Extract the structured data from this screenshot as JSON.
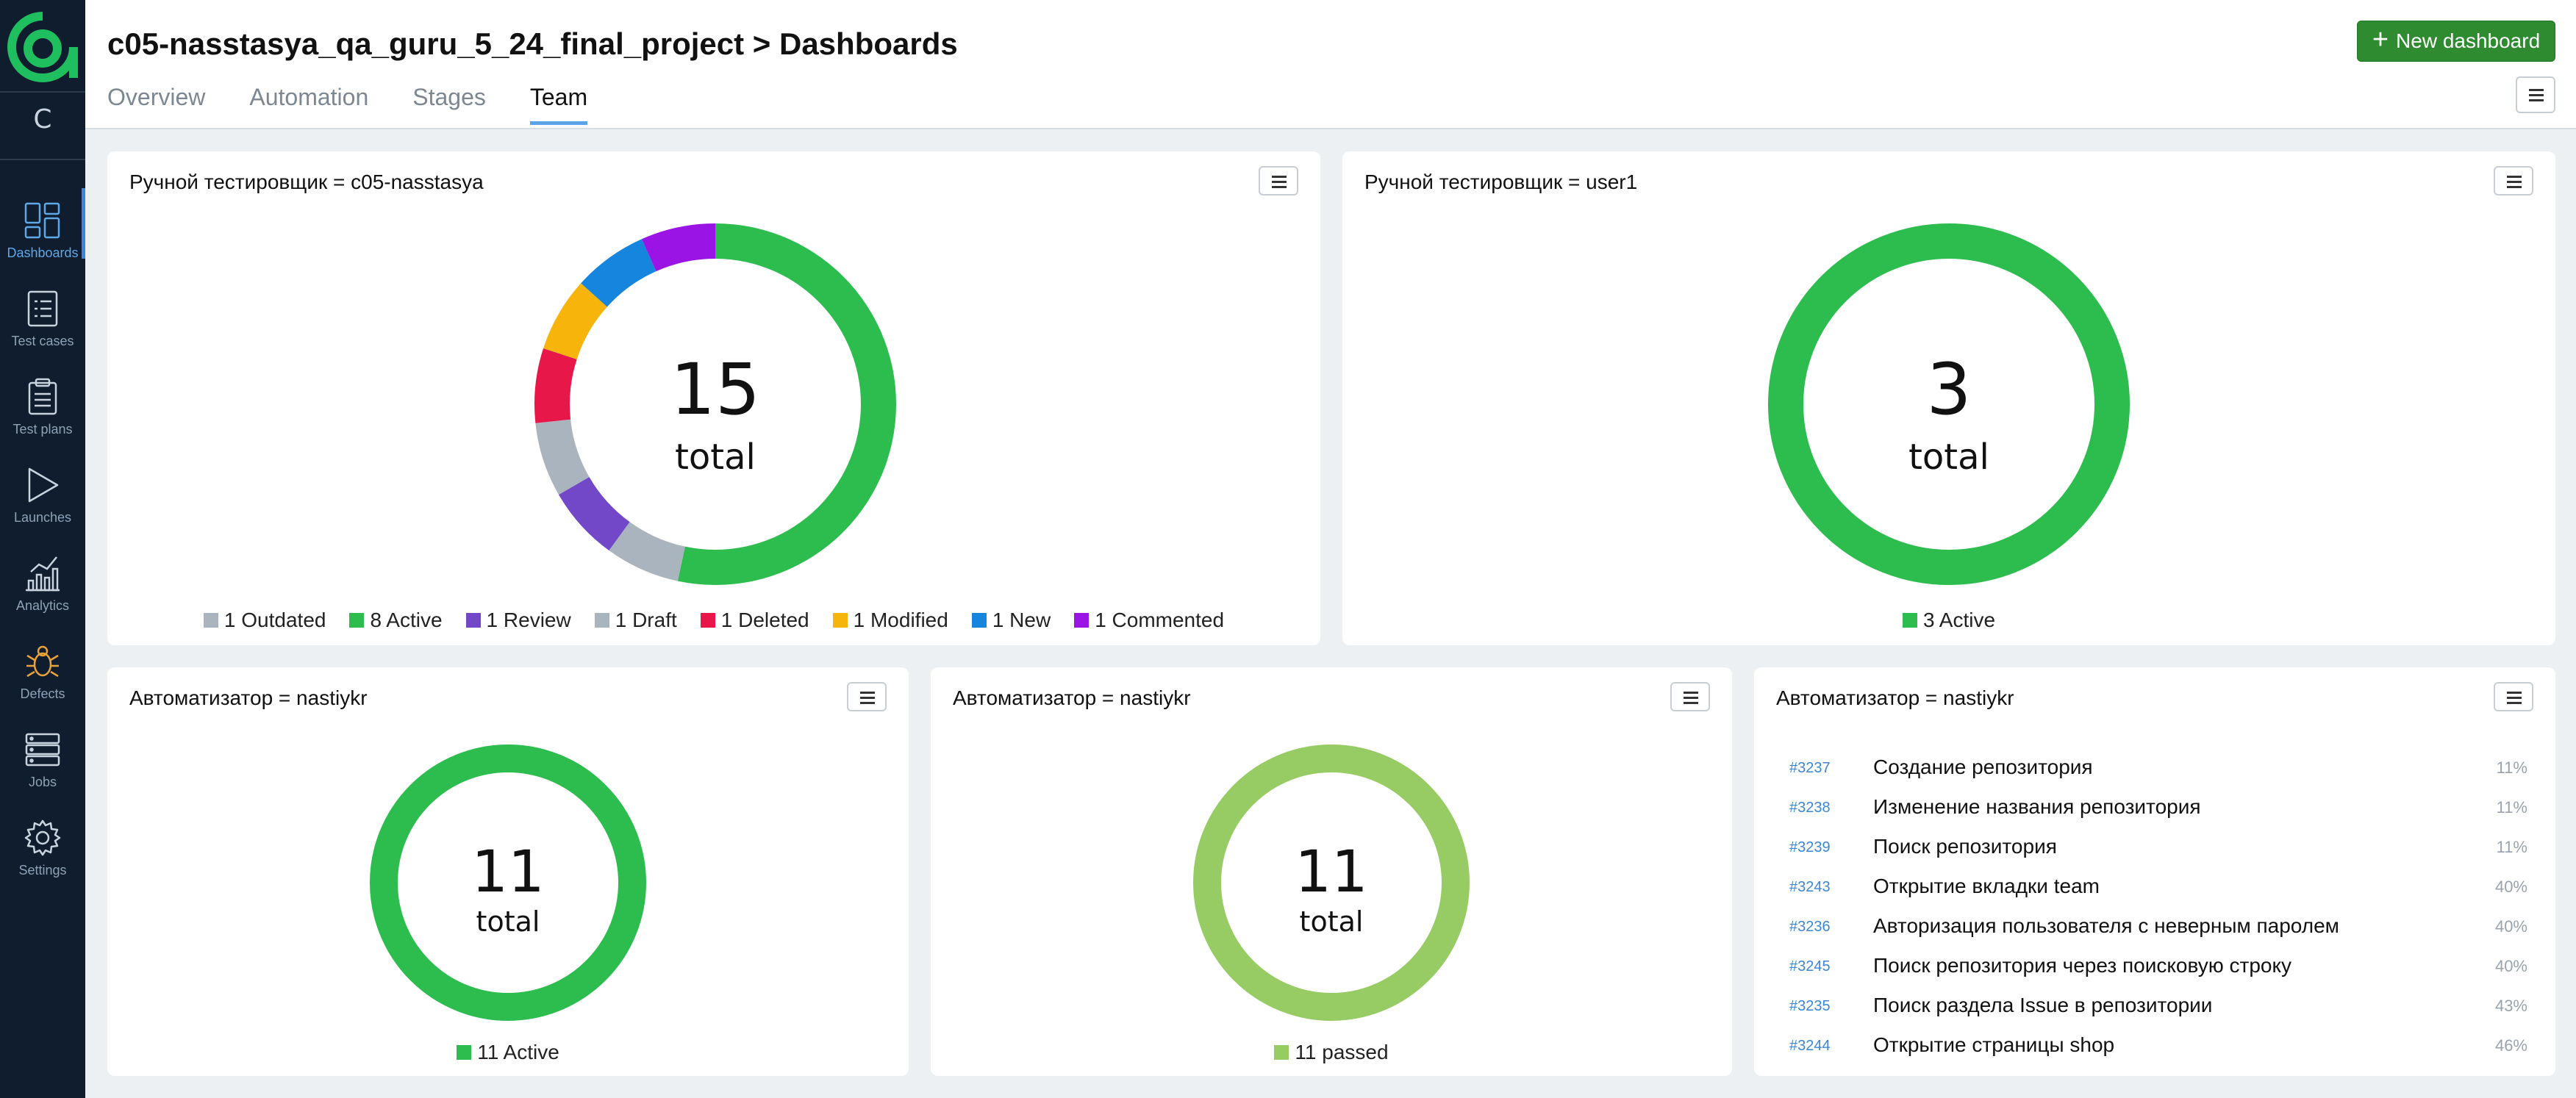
{
  "app": {
    "project_letter": "C",
    "title": "c05-nasstasya_qa_guru_5_24_final_project > Dashboards",
    "new_dashboard_label": "New dashboard"
  },
  "sidebar": {
    "items": [
      {
        "label": "Dashboards",
        "icon": "dashboards-icon"
      },
      {
        "label": "Test cases",
        "icon": "test-cases-icon"
      },
      {
        "label": "Test plans",
        "icon": "test-plans-icon"
      },
      {
        "label": "Launches",
        "icon": "launches-icon"
      },
      {
        "label": "Analytics",
        "icon": "analytics-icon"
      },
      {
        "label": "Defects",
        "icon": "defects-icon"
      },
      {
        "label": "Jobs",
        "icon": "jobs-icon"
      },
      {
        "label": "Settings",
        "icon": "settings-icon"
      }
    ]
  },
  "tabs": [
    {
      "label": "Overview"
    },
    {
      "label": "Automation"
    },
    {
      "label": "Stages"
    },
    {
      "label": "Team",
      "active": true
    }
  ],
  "colors": {
    "active": "#2dbd4e",
    "outdated": "#aab4bf",
    "review": "#7248c9",
    "draft": "#aab4bf",
    "deleted": "#e8174a",
    "modified": "#f7b50c",
    "new": "#1585de",
    "commented": "#9a14e6",
    "passed": "#97cc64",
    "accent": "#3d86d9",
    "button_green": "#2e8b2f"
  },
  "widgets": {
    "manual1": {
      "title": "Ручной тестировщик = c05-nasstasya",
      "total": "15",
      "total_label": "total",
      "legend": [
        {
          "label": "1 Outdated",
          "key": "outdated",
          "value": 1
        },
        {
          "label": "8 Active",
          "key": "active",
          "value": 8
        },
        {
          "label": "1 Review",
          "key": "review",
          "value": 1
        },
        {
          "label": "1 Draft",
          "key": "draft",
          "value": 1
        },
        {
          "label": "1 Deleted",
          "key": "deleted",
          "value": 1
        },
        {
          "label": "1 Modified",
          "key": "modified",
          "value": 1
        },
        {
          "label": "1 New",
          "key": "new",
          "value": 1
        },
        {
          "label": "1 Commented",
          "key": "commented",
          "value": 1
        }
      ]
    },
    "manual2": {
      "title": "Ручной тестировщик = user1",
      "total": "3",
      "total_label": "total",
      "legend": [
        {
          "label": "3 Active",
          "key": "active",
          "value": 3
        }
      ]
    },
    "auto1": {
      "title": "Автоматизатор = nastiykr",
      "total": "11",
      "total_label": "total",
      "legend": [
        {
          "label": "11 Active",
          "key": "active",
          "value": 11
        }
      ]
    },
    "auto2": {
      "title": "Автоматизатор = nastiykr",
      "total": "11",
      "total_label": "total",
      "legend": [
        {
          "label": "11 passed",
          "key": "passed",
          "value": 11
        }
      ]
    },
    "auto3": {
      "title": "Автоматизатор = nastiykr",
      "rows": [
        {
          "id": "#3237",
          "name": "Создание репозитория",
          "pct": "11%"
        },
        {
          "id": "#3238",
          "name": "Изменение названия репозитория",
          "pct": "11%"
        },
        {
          "id": "#3239",
          "name": "Поиск репозитория",
          "pct": "11%"
        },
        {
          "id": "#3243",
          "name": "Открытие вкладки team",
          "pct": "40%"
        },
        {
          "id": "#3236",
          "name": "Авторизация пользователя с неверным паролем",
          "pct": "40%"
        },
        {
          "id": "#3245",
          "name": "Поиск репозитория через поисковую строку",
          "pct": "40%"
        },
        {
          "id": "#3235",
          "name": "Поиск раздела Issue в репозитории",
          "pct": "43%"
        },
        {
          "id": "#3244",
          "name": "Открытие страницы shop",
          "pct": "46%"
        }
      ]
    }
  }
}
